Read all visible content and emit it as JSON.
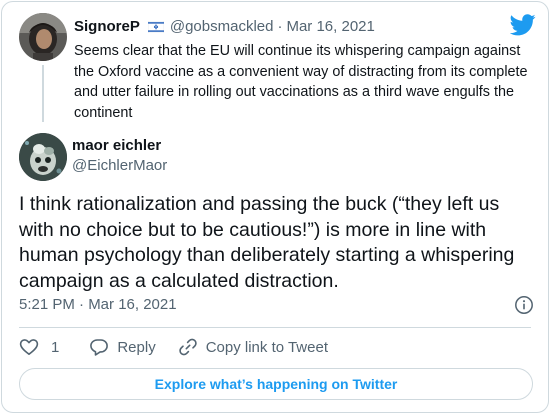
{
  "brand": {
    "logo_icon": "twitter-bird-icon",
    "accent_color": "#1d9bf0"
  },
  "parent_tweet": {
    "author_name": "SignoreP",
    "flag_icon": "israel-flag-icon",
    "handle": "@gobsmackled",
    "separator": "·",
    "date": "Mar 16, 2021",
    "text": "Seems clear that the EU will continue its whispering campaign against the Oxford vaccine as a convenient way of distracting from its complete and utter failure in rolling out vaccinations as a third wave engulfs the continent"
  },
  "tweet": {
    "author_name": "maor eichler",
    "handle": "@EichlerMaor",
    "text": "I think rationalization and passing the buck (“they left us with no choice but to be cautious!”) is more in line with human psychology than deliberately starting a whispering campaign as a calculated distraction.",
    "timestamp": "5:21 PM · Mar 16, 2021"
  },
  "actions": {
    "like_count": "1",
    "reply_label": "Reply",
    "copy_link_label": "Copy link to Tweet"
  },
  "footer": {
    "explore_label": "Explore what’s happening on Twitter"
  }
}
